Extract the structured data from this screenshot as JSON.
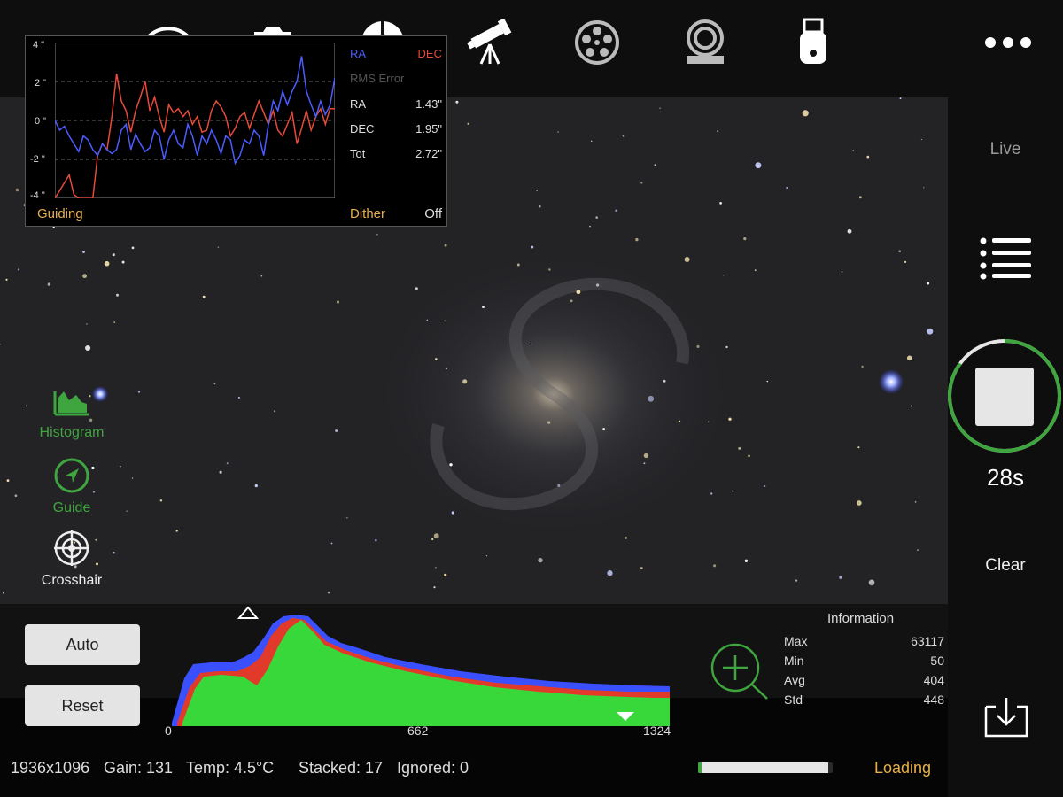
{
  "colors": {
    "accent_green": "#3fa53f",
    "ra_blue": "#4a5cff",
    "dec_red": "#e64a3a",
    "orange": "#e8b04a"
  },
  "toolbar": {
    "icons": [
      "wifi-icon",
      "camera-icon",
      "guide-target-icon",
      "telescope-icon",
      "filter-wheel-icon",
      "focuser-icon",
      "usb-drive-icon"
    ],
    "more": "more-icon"
  },
  "guiding": {
    "yticks": [
      "4 \"",
      "2 \"",
      "0 \"",
      "-2 \"",
      "-4 \""
    ],
    "legend_ra": "RA",
    "legend_dec": "DEC",
    "rms_label": "RMS Error",
    "ra_label": "RA",
    "ra_value": "1.43\"",
    "dec_label": "DEC",
    "dec_value": "1.95\"",
    "tot_label": "Tot",
    "tot_value": "2.72\"",
    "title": "Guiding",
    "dither_label": "Dither",
    "dither_value": "Off"
  },
  "chart_data": {
    "type": "line",
    "ylim": [
      -4,
      4
    ],
    "x": [
      0,
      1,
      2,
      3,
      4,
      5,
      6,
      7,
      8,
      9,
      10,
      11,
      12,
      13,
      14,
      15,
      16,
      17,
      18,
      19,
      20,
      21,
      22,
      23,
      24,
      25,
      26,
      27,
      28,
      29,
      30,
      31,
      32,
      33,
      34,
      35,
      36,
      37,
      38,
      39,
      40,
      41,
      42,
      43,
      44,
      45,
      46,
      47,
      48,
      49,
      50,
      51,
      52,
      53,
      54,
      55,
      56,
      57,
      58,
      59
    ],
    "series": [
      {
        "name": "RA",
        "color": "#4a5cff",
        "values": [
          0,
          -0.5,
          -0.3,
          -0.8,
          -1.2,
          -1.6,
          -0.8,
          -1.0,
          -1.5,
          -1.8,
          -1.2,
          -1.5,
          -1.7,
          -1.5,
          -0.5,
          -0.2,
          -1.5,
          -0.7,
          -1.2,
          -1.6,
          -1.4,
          -0.5,
          -0.8,
          -2.0,
          -1.0,
          -0.5,
          -1.2,
          -1.4,
          -0.2,
          -0.8,
          -1.8,
          -0.8,
          -1.2,
          -0.5,
          -1.0,
          -1.7,
          -0.8,
          -1.0,
          -2.2,
          -1.8,
          -1.0,
          -1.2,
          -0.5,
          -0.8,
          -1.8,
          -0.2,
          1.0,
          0.5,
          1.5,
          0.8,
          1.5,
          2.0,
          3.3,
          1.5,
          0.8,
          0.2,
          1.0,
          0.3,
          0.8,
          2.2
        ]
      },
      {
        "name": "DEC",
        "color": "#e64a3a",
        "values": [
          -4,
          -3.6,
          -3.2,
          -2.8,
          -3.8,
          -4,
          -4.2,
          -4,
          -4.5,
          -1.8,
          -1.2,
          -1.5,
          0.2,
          2.4,
          1.0,
          0.5,
          -0.6,
          0.5,
          1.2,
          2.0,
          0.5,
          1.2,
          0.2,
          -0.6,
          0.8,
          0.4,
          0.6,
          0.2,
          0.5,
          -0.2,
          0.2,
          -0.6,
          -0.5,
          0.5,
          1.0,
          0.7,
          0.2,
          -0.8,
          -0.4,
          0.2,
          0.4,
          -0.4,
          0.3,
          1.0,
          0.4,
          -0.2,
          0.5,
          -0.5,
          -0.8,
          -0.2,
          0.4,
          -1.2,
          -0.4,
          0.5,
          -0.5,
          0.2,
          0.6,
          -0.2,
          0.6,
          0.6
        ]
      }
    ]
  },
  "left_tools": [
    {
      "label": "Histogram",
      "icon": "histogram-icon"
    },
    {
      "label": "Guide",
      "icon": "guide-compass-icon"
    },
    {
      "label": "Crosshair",
      "icon": "crosshair-icon"
    }
  ],
  "right_panel": {
    "live": "Live",
    "timer": "28s",
    "clear": "Clear",
    "progress": 0.85
  },
  "histogram": {
    "auto": "Auto",
    "reset": "Reset",
    "ticks": [
      "0",
      "662",
      "1324"
    ]
  },
  "info": {
    "title": "Information",
    "rows": [
      {
        "k": "Max",
        "v": "63117"
      },
      {
        "k": "Min",
        "v": "50"
      },
      {
        "k": "Avg",
        "v": "404"
      },
      {
        "k": "Std",
        "v": "448"
      }
    ]
  },
  "status": {
    "resolution": "1936x1096",
    "gain": "Gain: 131",
    "temp": "Temp: 4.5°C",
    "stacked": "Stacked: 17",
    "ignored": "Ignored: 0",
    "loading": "Loading",
    "load_progress": 0.97
  }
}
